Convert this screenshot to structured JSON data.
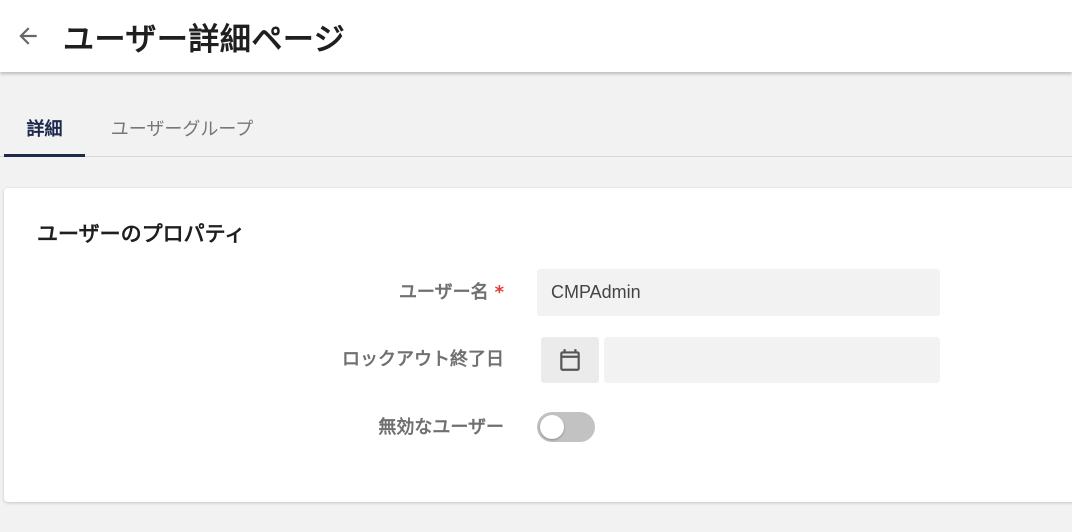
{
  "header": {
    "back_icon": "arrow-left-icon",
    "title": "ユーザー詳細ページ"
  },
  "tabs": [
    {
      "label": "詳細",
      "active": true
    },
    {
      "label": "ユーザーグループ",
      "active": false
    }
  ],
  "section": {
    "title": "ユーザーのプロパティ"
  },
  "fields": {
    "username": {
      "label": "ユーザー名",
      "required_mark": "*",
      "value": "CMPAdmin"
    },
    "lockout": {
      "label": "ロックアウト終了日",
      "icon": "calendar-icon",
      "value": ""
    },
    "disabled": {
      "label": "無効なユーザー",
      "enabled": false
    }
  },
  "colors": {
    "accent": "#1d2a4d",
    "required": "#e53935",
    "toggle_off": "#c2c2c2"
  }
}
